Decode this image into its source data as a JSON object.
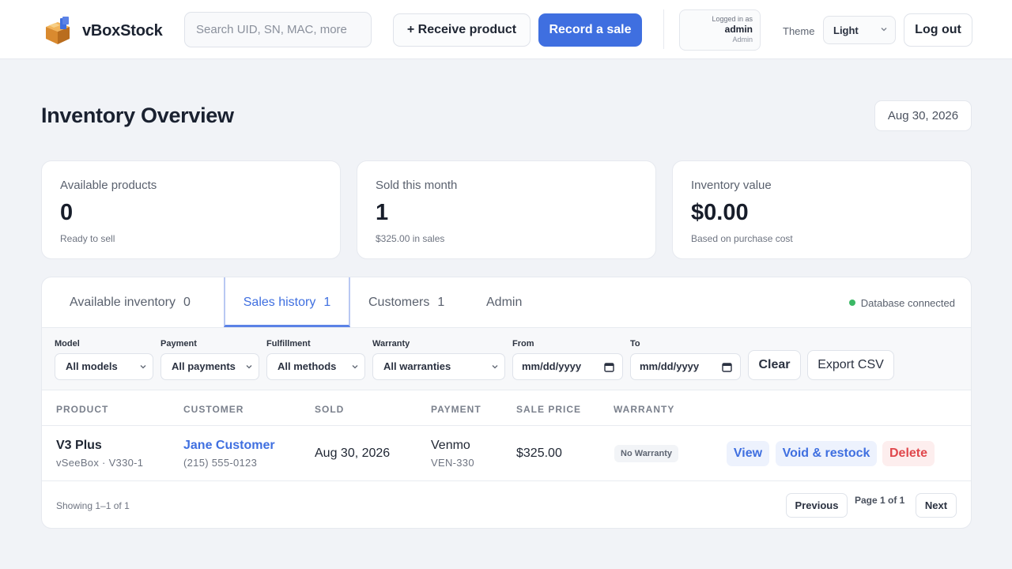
{
  "app": {
    "brand": "vBoxStock",
    "search_placeholder": "Search UID, SN, MAC, more",
    "receive_label": "+ Receive product",
    "record_sale_label": "Record a sale",
    "user": {
      "caption": "Logged in as",
      "name": "admin",
      "role": "Admin"
    },
    "theme_label": "Theme",
    "theme_value": "Light",
    "logout_label": "Log out",
    "accent_color": "#3f6fe0"
  },
  "page": {
    "title": "Inventory Overview",
    "date": "Aug 30, 2026"
  },
  "stats": [
    {
      "label": "Available products",
      "value": "0",
      "sub": "Ready to sell"
    },
    {
      "label": "Sold this month",
      "value": "1",
      "sub": "$325.00 in sales"
    },
    {
      "label": "Inventory value",
      "value": "$0.00",
      "sub": "Based on purchase cost"
    }
  ],
  "tabs": [
    {
      "label": "Available inventory",
      "count": "0"
    },
    {
      "label": "Sales history",
      "count": "1"
    },
    {
      "label": "Customers",
      "count": "1"
    },
    {
      "label": "Admin",
      "count": ""
    }
  ],
  "db_status": "Database connected",
  "filters": {
    "model": {
      "label": "Model",
      "value": "All models"
    },
    "payment": {
      "label": "Payment",
      "value": "All payments"
    },
    "fulfillment": {
      "label": "Fulfillment",
      "value": "All methods"
    },
    "warranty": {
      "label": "Warranty",
      "value": "All warranties"
    },
    "from": {
      "label": "From",
      "value": "mm/dd/yyyy"
    },
    "to": {
      "label": "To",
      "value": "mm/dd/yyyy"
    },
    "clear_label": "Clear",
    "export_label": "Export CSV"
  },
  "table": {
    "headers": [
      "PRODUCT",
      "CUSTOMER",
      "SOLD",
      "PAYMENT",
      "SALE PRICE",
      "WARRANTY"
    ],
    "rows": [
      {
        "product": "V3 Plus",
        "product_sub": "vSeeBox · V330-1",
        "customer": "Jane Customer",
        "customer_phone": "(215) 555-0123",
        "sold": "Aug 30, 2026",
        "payment": "Venmo",
        "payment_ref": "VEN-330",
        "price": "$325.00",
        "warranty": "No Warranty",
        "actions": {
          "view": "View",
          "void": "Void & restock",
          "delete": "Delete"
        }
      }
    ]
  },
  "footer": {
    "showing": "Showing 1–1 of 1",
    "previous": "Previous",
    "page_info": "Page 1 of 1",
    "next": "Next"
  }
}
